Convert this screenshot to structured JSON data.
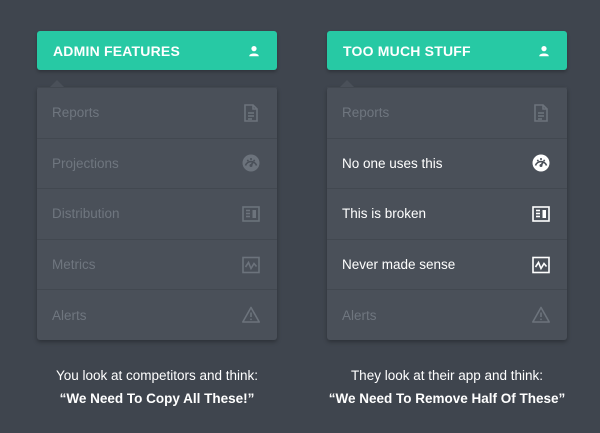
{
  "left_panel": {
    "title": "ADMIN FEATURES",
    "items": [
      {
        "label": "Reports",
        "icon": "document-icon"
      },
      {
        "label": "Projections",
        "icon": "gauge-icon"
      },
      {
        "label": "Distribution",
        "icon": "columns-icon"
      },
      {
        "label": "Metrics",
        "icon": "chart-icon"
      },
      {
        "label": "Alerts",
        "icon": "warning-icon"
      }
    ]
  },
  "right_panel": {
    "title": "TOO MUCH STUFF",
    "items": [
      {
        "label": "Reports",
        "icon": "document-icon"
      },
      {
        "label": "No one uses this",
        "icon": "gauge-icon"
      },
      {
        "label": "This is broken",
        "icon": "columns-icon"
      },
      {
        "label": "Never made sense",
        "icon": "chart-icon"
      },
      {
        "label": "Alerts",
        "icon": "warning-icon"
      }
    ]
  },
  "captions": {
    "left_line1": "You look at competitors and think:",
    "left_line2": "“We Need To Copy All These!”",
    "right_line1": "They look at their app and think:",
    "right_line2": "“We Need To Remove Half Of These”"
  },
  "colors": {
    "background": "#3f454e",
    "header": "#27c9a4",
    "menu": "#4a5059",
    "dim_text": "#6f767f",
    "bright_text": "#ffffff"
  }
}
